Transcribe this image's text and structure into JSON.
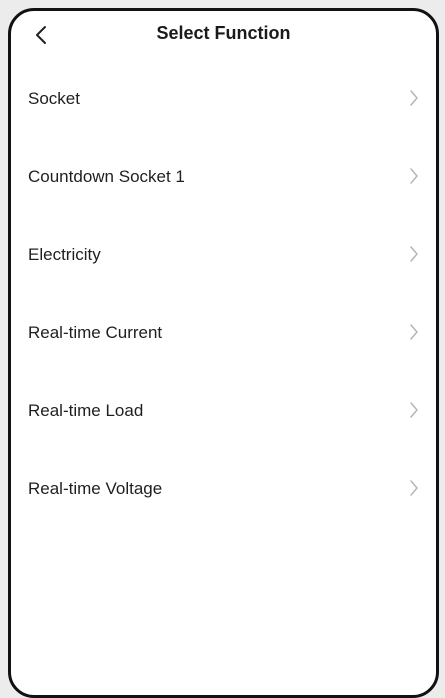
{
  "header": {
    "title": "Select Function",
    "back_icon": "chevron-left-icon"
  },
  "functions": [
    {
      "label": "Socket",
      "icon": "chevron-right-icon"
    },
    {
      "label": "Countdown Socket 1",
      "icon": "chevron-right-icon"
    },
    {
      "label": "Electricity",
      "icon": "chevron-right-icon"
    },
    {
      "label": "Real-time Current",
      "icon": "chevron-right-icon"
    },
    {
      "label": "Real-time Load",
      "icon": "chevron-right-icon"
    },
    {
      "label": "Real-time Voltage",
      "icon": "chevron-right-icon"
    }
  ],
  "colors": {
    "text": "#1f1f1f",
    "chevron": "#b5b5b5",
    "frame": "#111111",
    "background": "#ffffff"
  }
}
